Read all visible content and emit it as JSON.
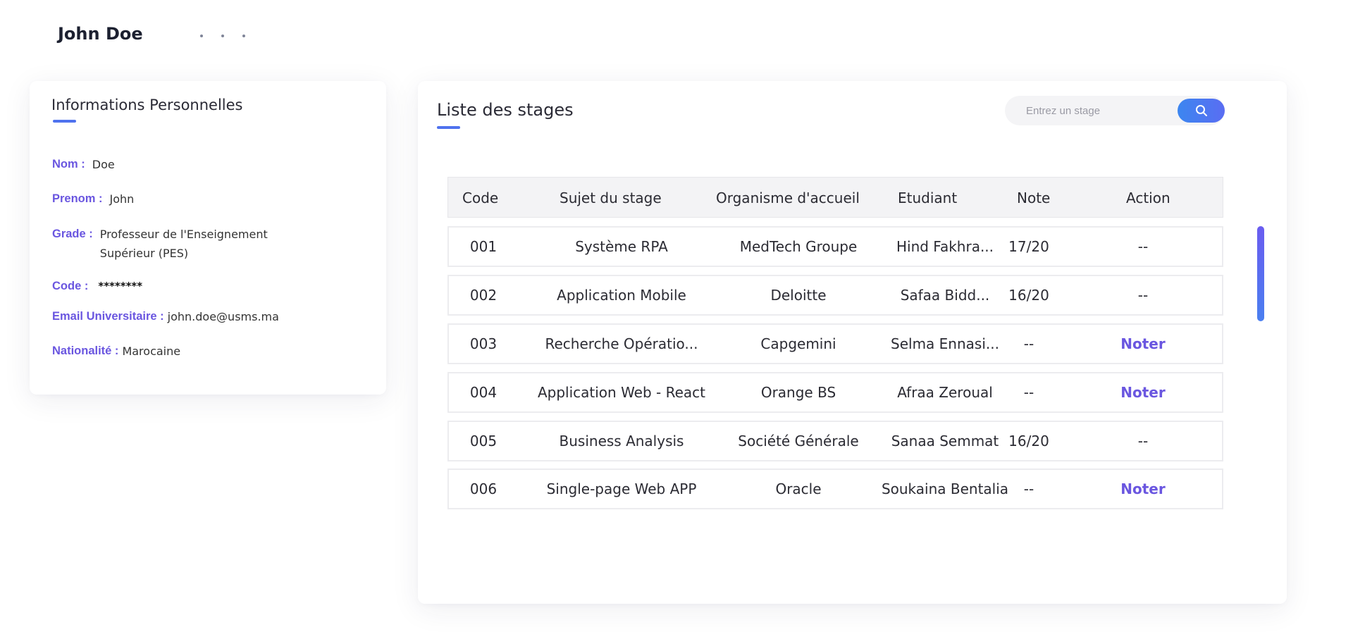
{
  "header": {
    "user_name": "John Doe"
  },
  "info": {
    "title": "Informations Personnelles",
    "nom_label": "Nom :",
    "nom_value": "Doe",
    "prenom_label": "Prenom :",
    "prenom_value": "John",
    "grade_label": "Grade :",
    "grade_value_line1": "Professeur de l'Enseignement",
    "grade_value_line2": "Supérieur (PES)",
    "code_label": "Code :",
    "code_value": "********",
    "email_label": "Email Universitaire :",
    "email_value": "john.doe@usms.ma",
    "nationalite_label": "Nationalité :",
    "nationalite_value": "Marocaine"
  },
  "stages": {
    "title": "Liste des stages",
    "search_placeholder": "Entrez un stage",
    "columns": [
      "Code",
      "Sujet du stage",
      "Organisme d'accueil",
      "Etudiant",
      "Note",
      "Action"
    ],
    "rows": [
      {
        "code": "001",
        "sujet": "Système RPA",
        "organisme": "MedTech Groupe",
        "etudiant": "Hind Fakhra...",
        "note": "17/20",
        "action": "--"
      },
      {
        "code": "002",
        "sujet": "Application Mobile",
        "organisme": "Deloitte",
        "etudiant": "Safaa Bidd...",
        "note": "16/20",
        "action": "--"
      },
      {
        "code": "003",
        "sujet": "Recherche Opératio...",
        "organisme": "Capgemini",
        "etudiant": "Selma Ennasi...",
        "note": "--",
        "action": "Noter"
      },
      {
        "code": "004",
        "sujet": "Application Web - React",
        "organisme": "Orange BS",
        "etudiant": "Afraa Zeroual",
        "note": "--",
        "action": "Noter"
      },
      {
        "code": "005",
        "sujet": "Business Analysis",
        "organisme": "Société Générale",
        "etudiant": "Sanaa Semmat",
        "note": "16/20",
        "action": "--"
      },
      {
        "code": "006",
        "sujet": "Single-page Web APP",
        "organisme": "Oracle",
        "etudiant": "Soukaina Bentalia",
        "note": "--",
        "action": "Noter"
      }
    ]
  },
  "colors": {
    "accent": "#6a56e0",
    "primary_blue": "#4f72ee"
  },
  "icons": {
    "search": "search-icon"
  }
}
